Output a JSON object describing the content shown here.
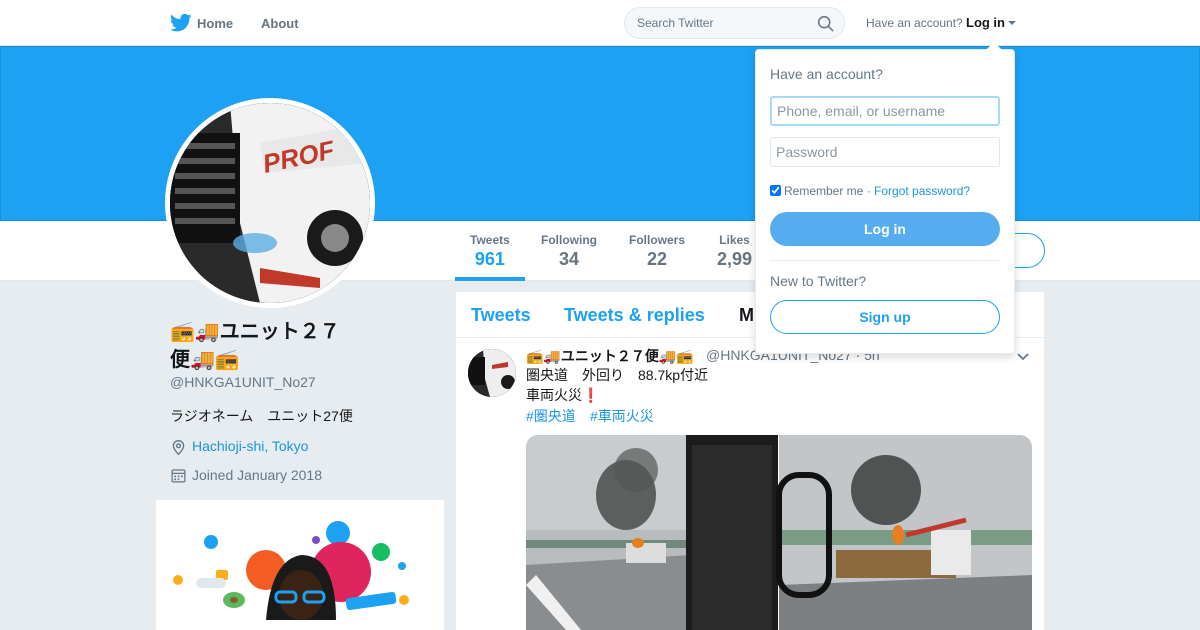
{
  "nav": {
    "home_label": "Home",
    "about_label": "About",
    "search_placeholder": "Search Twitter",
    "have_account": "Have an account?",
    "login_label": "Log in"
  },
  "profile": {
    "name_line1": "📻🚚ユニット２７",
    "name_line2": "便🚚📻",
    "handle": "@HNKGA1UNIT_No27",
    "bio": "ラジオネーム　ユニット27便",
    "location": "Hachioji-shi, Tokyo",
    "joined": "Joined January 2018"
  },
  "stats": [
    {
      "label": "Tweets",
      "value": "961"
    },
    {
      "label": "Following",
      "value": "34"
    },
    {
      "label": "Followers",
      "value": "22"
    },
    {
      "label": "Likes",
      "value": "2,99"
    }
  ],
  "tabs": [
    "Tweets",
    "Tweets & replies",
    "M"
  ],
  "tweet": {
    "name": "📻🚚ユニット２７便🚚📻",
    "handle_time": "@HNKGA1UNIT_No27 · 5h",
    "line1": "圏央道　外回り　88.7kp付近",
    "line2": "車両火災❗",
    "hashtags": [
      "#圏央道",
      "#車両火災"
    ]
  },
  "login_dropdown": {
    "title": "Have an account?",
    "username_placeholder": "Phone, email, or username",
    "password_placeholder": "Password",
    "remember_label": "Remember me",
    "separator": " · ",
    "forgot_label": "Forgot password?",
    "login_button": "Log in",
    "new_to_twitter": "New to Twitter?",
    "signup_button": "Sign up"
  },
  "colors": {
    "brand": "#1da1f2",
    "banner": "#1da1f2",
    "link": "#1b95e0"
  }
}
